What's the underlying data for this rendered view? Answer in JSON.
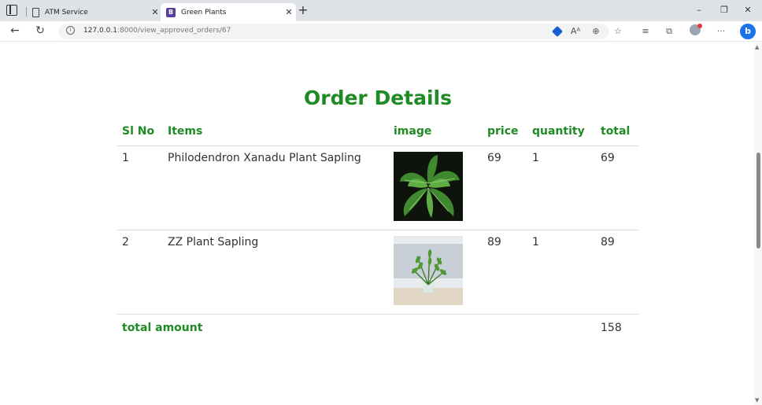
{
  "browser": {
    "tabs": [
      {
        "label": "ATM Service",
        "icon": "document-icon",
        "active": false
      },
      {
        "label": "Green Plants",
        "icon": "bootstrap-icon",
        "active": true
      }
    ],
    "address": {
      "host": "127.0.0.1",
      "path": ":8000/view_approved_orders/67"
    },
    "profile_initial": "b"
  },
  "page": {
    "title": "Order Details",
    "accent_color": "#1f8b24",
    "table": {
      "headers": [
        "Sl No",
        "Items",
        "image",
        "price",
        "quantity",
        "total"
      ],
      "rows": [
        {
          "sl": "1",
          "item": "Philodendron Xanadu Plant Sapling",
          "image": "philodendron-plant-image",
          "price": "69",
          "quantity": "1",
          "total": "69"
        },
        {
          "sl": "2",
          "item": "ZZ Plant Sapling",
          "image": "zz-plant-image",
          "price": "89",
          "quantity": "1",
          "total": "89"
        }
      ],
      "total_label": "total amount",
      "total_value": "158"
    }
  }
}
